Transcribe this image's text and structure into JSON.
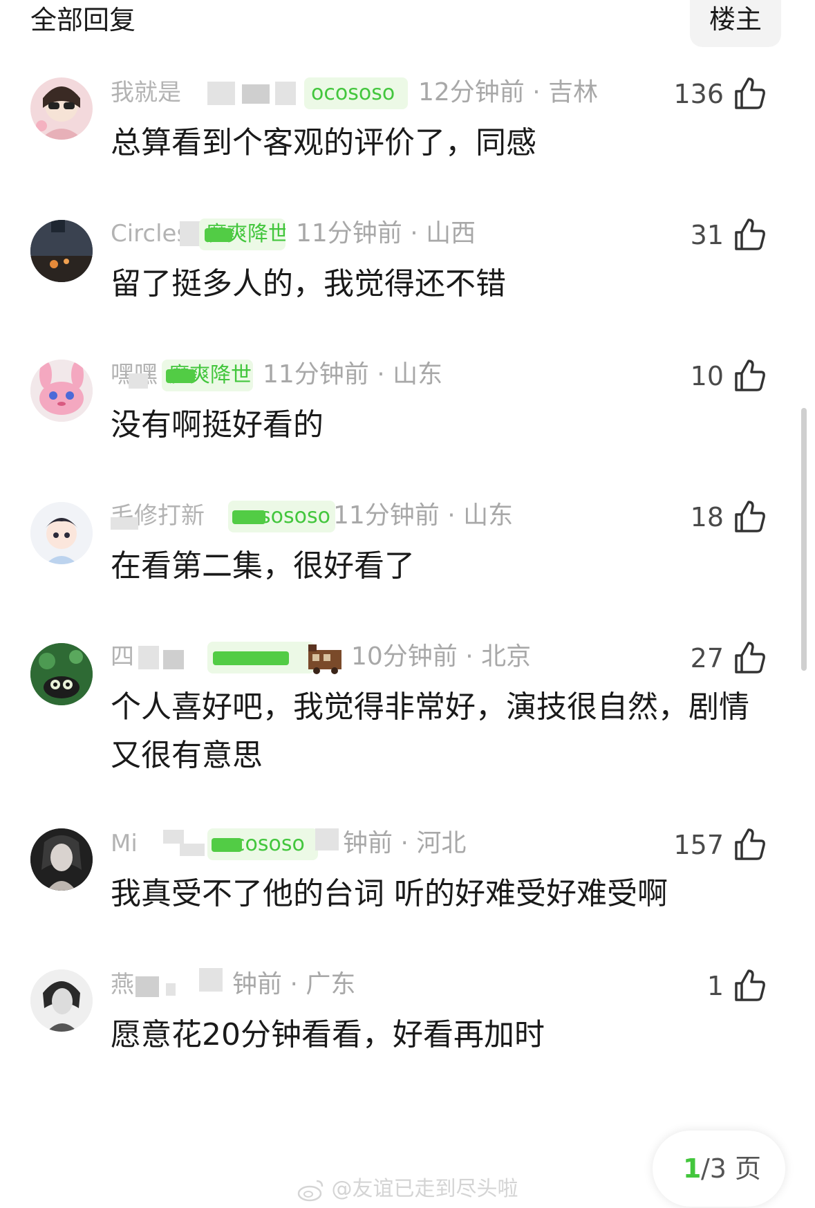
{
  "header": {
    "title": "全部回复",
    "op_tab": "楼主"
  },
  "comments": [
    {
      "username": "我就是",
      "badge": "ocososo",
      "time": "12分钟前 · 吉林",
      "likes": "136",
      "text": "总算看到个客观的评价了，同感"
    },
    {
      "username": "Circles",
      "badge": "魔爽降世",
      "time": "11分钟前 · 山西",
      "likes": "31",
      "text": "留了挺多人的，我觉得还不错"
    },
    {
      "username": "嘿嘿",
      "badge": "魔爽降世",
      "time": "11分钟前 · 山东",
      "likes": "10",
      "text": "没有啊挺好看的"
    },
    {
      "username": "毛修打新",
      "badge": "sososo",
      "time": "11分钟前 · 山东",
      "likes": "18",
      "text": "在看第二集，很好看了"
    },
    {
      "username": "四",
      "badge": "",
      "time": "10分钟前 · 北京",
      "likes": "27",
      "text": "个人喜好吧，我觉得非常好，演技很自然，剧情又很有意思"
    },
    {
      "username": "Mi",
      "badge": "cososo",
      "time": "钟前 · 河北",
      "likes": "157",
      "text": "我真受不了他的台词 听的好难受好难受啊"
    },
    {
      "username": "燕",
      "badge": "",
      "time": "钟前 · 广东",
      "likes": "1",
      "text": "愿意花20分钟看看，好看再加时"
    }
  ],
  "pager": {
    "current": "1",
    "rest": "/3 页"
  },
  "watermark": "@友谊已走到尽头啦",
  "colors": {
    "accent_green": "#43c63d",
    "badge_bg": "#ecf9e6",
    "meta_gray": "#a8a8a8"
  },
  "icons": {
    "like": "thumbs-up-icon",
    "watermark": "weibo-icon"
  }
}
